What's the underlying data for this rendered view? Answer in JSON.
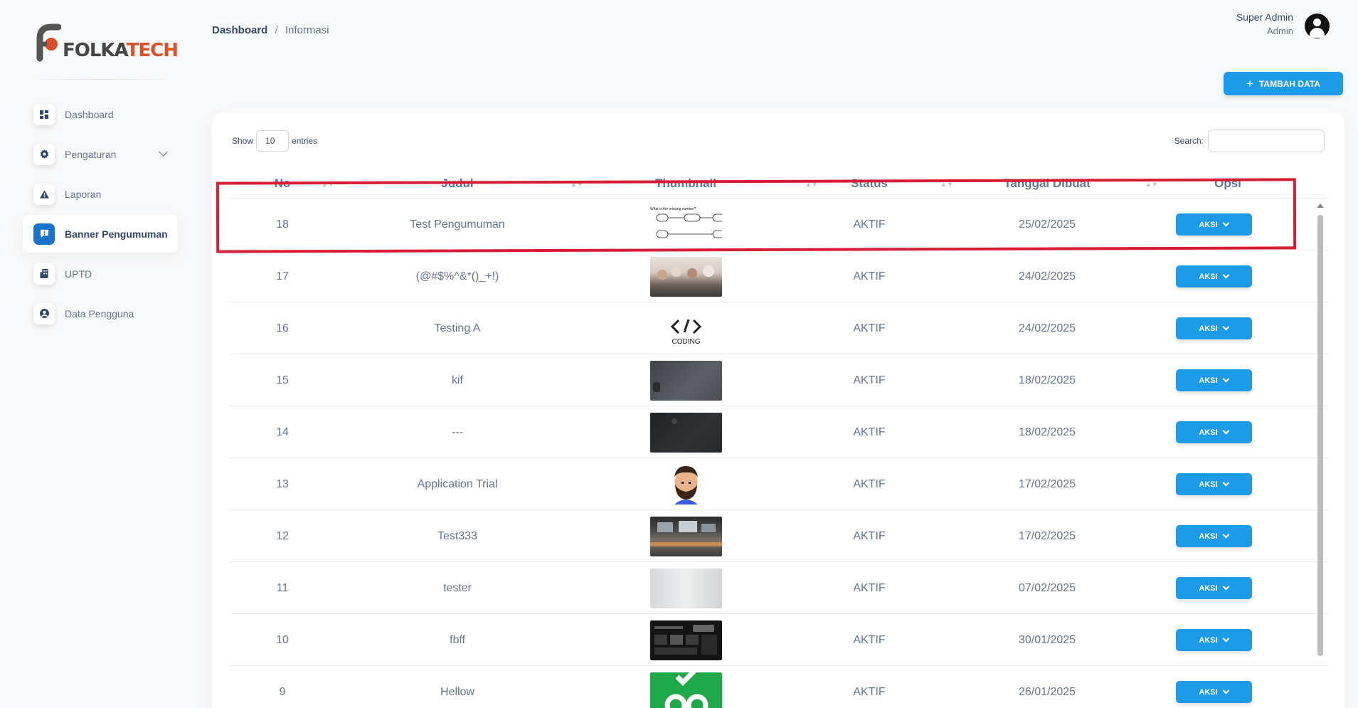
{
  "brand": {
    "logo_prefix": "FOLKA",
    "logo_suffix": "TECH",
    "accent": "#d8512b"
  },
  "sidebar": {
    "items": [
      {
        "label": "Dashboard",
        "icon": "dashboard-icon",
        "active": false
      },
      {
        "label": "Pengaturan",
        "icon": "gear-icon",
        "active": false,
        "has_submenu": true
      },
      {
        "label": "Laporan",
        "icon": "warning-icon",
        "active": false
      },
      {
        "label": "Banner Pengumuman",
        "icon": "announcement-icon",
        "active": true
      },
      {
        "label": "UPTD",
        "icon": "building-icon",
        "active": false
      },
      {
        "label": "Data Pengguna",
        "icon": "user-circle-icon",
        "active": false
      }
    ]
  },
  "header": {
    "breadcrumb_home": "Dashboard",
    "breadcrumb_sep": "/",
    "breadcrumb_current": "Informasi",
    "user_name": "Super Admin",
    "user_role": "Admin",
    "add_button": "TAMBAH DATA",
    "add_button_icon": "+"
  },
  "table_controls": {
    "show_label": "Show",
    "entries_value": "10",
    "entries_label": "entries",
    "search_label": "Search:"
  },
  "table": {
    "columns": [
      "No",
      "Judul",
      "Thumbnail",
      "Status",
      "Tanggal Dibuat",
      "Opsi"
    ],
    "rows": [
      {
        "no": "18",
        "judul": "Test Pengumuman",
        "thumbnail": "quiz-image",
        "status": "AKTIF",
        "date": "25/02/2025",
        "action": "AKSI"
      },
      {
        "no": "17",
        "judul": "(@#$%^&*()_+!)",
        "thumbnail": "group-photo",
        "status": "AKTIF",
        "date": "24/02/2025",
        "action": "AKSI"
      },
      {
        "no": "16",
        "judul": "Testing A",
        "thumbnail": "coding-logo",
        "status": "AKTIF",
        "date": "24/02/2025",
        "action": "AKSI"
      },
      {
        "no": "15",
        "judul": "kif",
        "thumbnail": "desk-photo",
        "status": "AKTIF",
        "date": "18/02/2025",
        "action": "AKSI"
      },
      {
        "no": "14",
        "judul": "---",
        "thumbnail": "dark-desk-photo",
        "status": "AKTIF",
        "date": "18/02/2025",
        "action": "AKSI"
      },
      {
        "no": "13",
        "judul": "Application Trial",
        "thumbnail": "avatar-illustration",
        "status": "AKTIF",
        "date": "17/02/2025",
        "action": "AKSI"
      },
      {
        "no": "12",
        "judul": "Test333",
        "thumbnail": "studio-photo",
        "status": "AKTIF",
        "date": "17/02/2025",
        "action": "AKSI"
      },
      {
        "no": "11",
        "judul": "tester",
        "thumbnail": "blurred-photo",
        "status": "AKTIF",
        "date": "07/02/2025",
        "action": "AKSI"
      },
      {
        "no": "10",
        "judul": "fbff",
        "thumbnail": "dashboard-screenshot",
        "status": "AKTIF",
        "date": "30/01/2025",
        "action": "AKSI"
      },
      {
        "no": "9",
        "judul": "Hellow",
        "thumbnail": "green-logo",
        "status": "AKTIF",
        "date": "26/01/2025",
        "action": "AKSI"
      }
    ]
  },
  "thumb_text": {
    "quiz_question": "What is the missing number?",
    "coding_label": "CODING"
  },
  "colors": {
    "primary_button": "#1e9be8",
    "active_nav": "#1a73c8",
    "highlight": "#d91c35"
  }
}
